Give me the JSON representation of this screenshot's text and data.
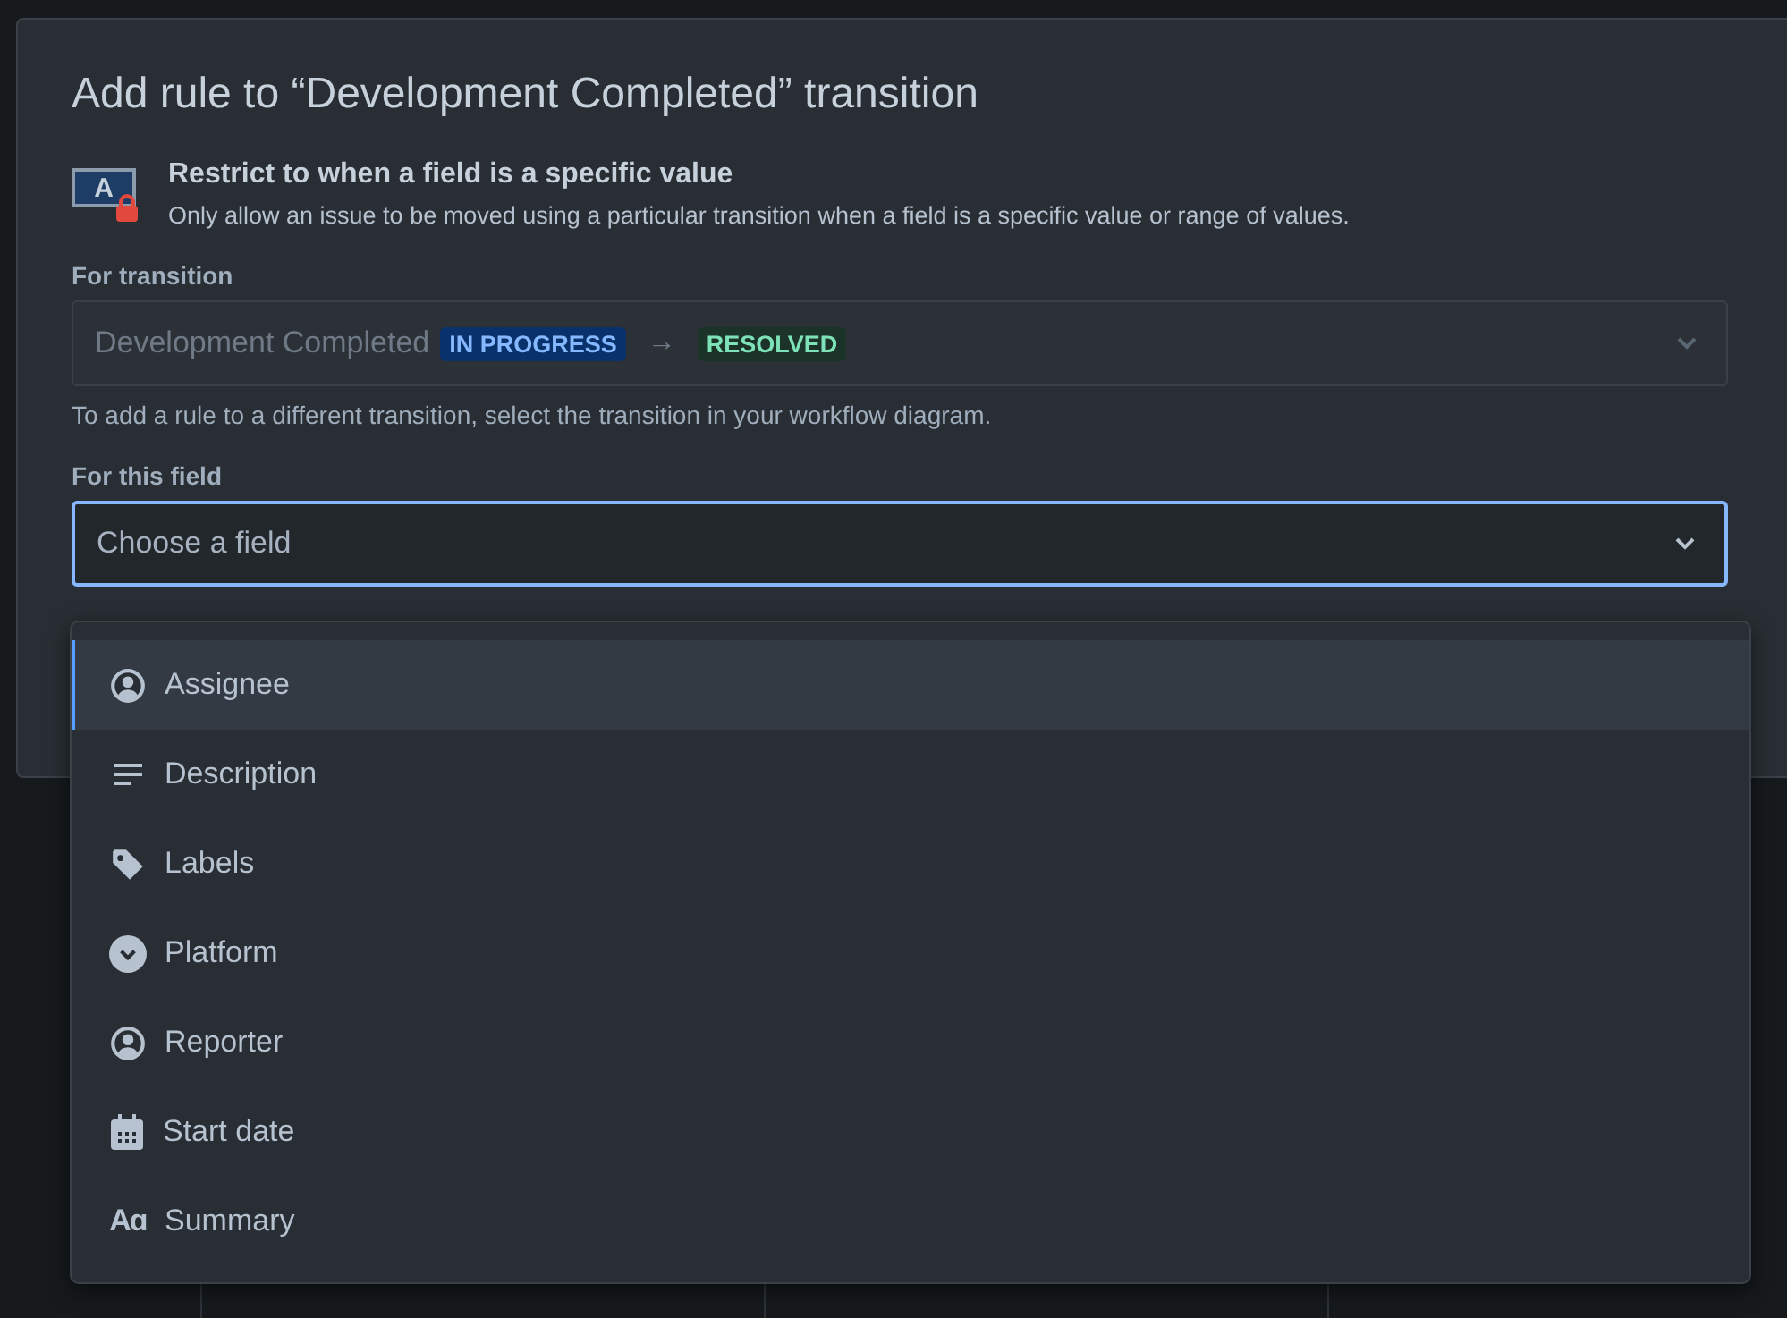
{
  "dialog": {
    "title": "Add rule to “Development Completed” transition",
    "rule": {
      "icon_letter": "A",
      "name": "Restrict to when a field is a specific value",
      "description": "Only allow an issue to be moved using a particular transition when a field is a specific value or range of values."
    },
    "transition_field": {
      "label": "For transition",
      "value": "Development Completed",
      "from_status": "IN PROGRESS",
      "arrow": "→",
      "to_status": "RESOLVED",
      "disabled": true,
      "helper": "To add a rule to a different transition, select the transition in your workflow diagram."
    },
    "field_select": {
      "label": "For this field",
      "placeholder": "Choose a field",
      "focused": true
    },
    "menu": [
      {
        "label": "Assignee",
        "kind": "user",
        "selected": true
      },
      {
        "label": "Description",
        "kind": "paragraph",
        "selected": false
      },
      {
        "label": "Labels",
        "kind": "tag",
        "selected": false
      },
      {
        "label": "Platform",
        "kind": "select",
        "selected": false
      },
      {
        "label": "Reporter",
        "kind": "user",
        "selected": false
      },
      {
        "label": "Start date",
        "kind": "date",
        "selected": false
      },
      {
        "label": "Summary",
        "kind": "text",
        "glyph": "Aɑ",
        "selected": false
      }
    ]
  }
}
